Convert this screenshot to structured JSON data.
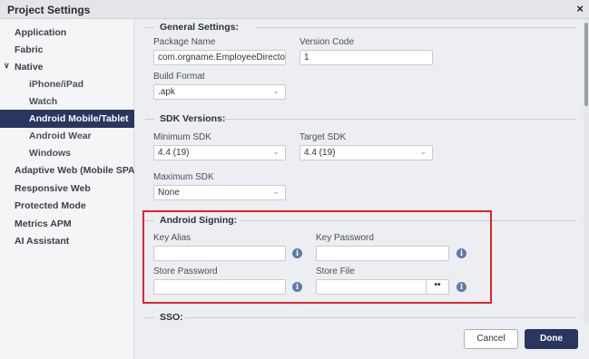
{
  "window": {
    "title": "Project Settings",
    "close": "×"
  },
  "sidebar": {
    "items": [
      {
        "label": "Application"
      },
      {
        "label": "Fabric"
      },
      {
        "label": "Native",
        "chevron": "∨"
      },
      {
        "label": "iPhone/iPad"
      },
      {
        "label": "Watch"
      },
      {
        "label": "Android Mobile/Tablet"
      },
      {
        "label": "Android Wear"
      },
      {
        "label": "Windows"
      },
      {
        "label": "Adaptive Web (Mobile SPA)"
      },
      {
        "label": "Responsive Web"
      },
      {
        "label": "Protected Mode"
      },
      {
        "label": "Metrics APM"
      },
      {
        "label": "AI Assistant"
      }
    ]
  },
  "general": {
    "title": "General Settings:",
    "package_name_label": "Package Name",
    "package_name_value": "com.orgname.EmployeeDirectory",
    "version_code_label": "Version Code",
    "version_code_value": "1",
    "build_format_label": "Build Format",
    "build_format_value": ".apk"
  },
  "sdk": {
    "title": "SDK Versions:",
    "min_label": "Minimum SDK",
    "min_value": "4.4 (19)",
    "target_label": "Target SDK",
    "target_value": "4.4 (19)",
    "max_label": "Maximum SDK",
    "max_value": "None"
  },
  "signing": {
    "title": "Android Signing:",
    "key_alias_label": "Key Alias",
    "key_password_label": "Key Password",
    "store_password_label": "Store Password",
    "store_file_label": "Store File",
    "browse_label": "••",
    "info_glyph": "i",
    "highlight_color": "#e0232a"
  },
  "sso": {
    "title": "SSO:"
  },
  "footer": {
    "cancel_label": "Cancel",
    "done_label": "Done"
  },
  "icons": {
    "caret": "⌄"
  },
  "colors": {
    "accent": "#2a3560",
    "info": "#5f7ca8"
  }
}
